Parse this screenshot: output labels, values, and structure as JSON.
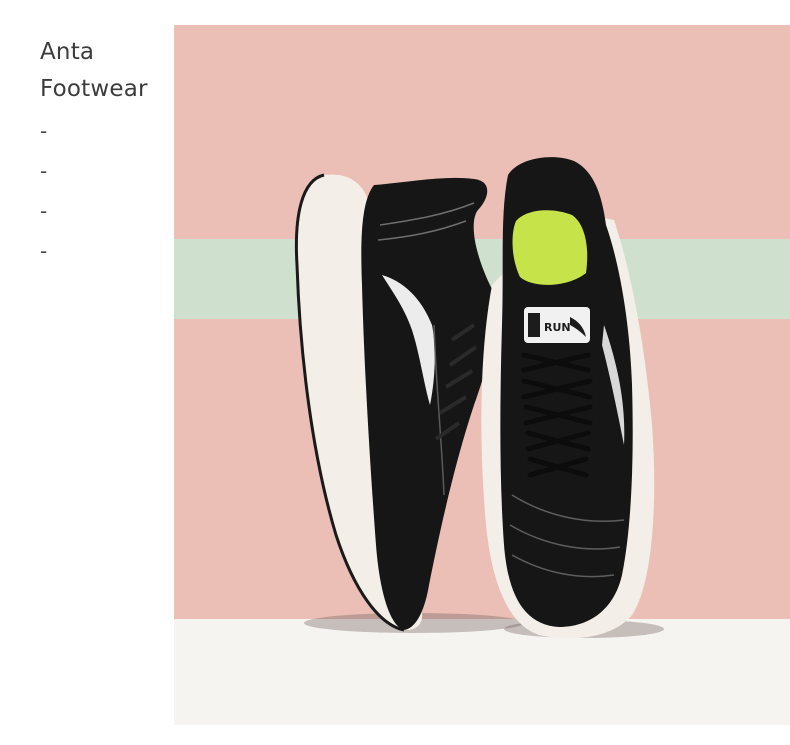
{
  "sidebar": {
    "brand_line1": "Anta",
    "brand_line2": "Footwear",
    "dashes": [
      "-",
      "-",
      "-",
      "-"
    ]
  },
  "photo": {
    "logo_text": "RUN",
    "colors": {
      "wall": "#ebbfb6",
      "stripe": "#cfe0cf",
      "floor": "#f6f4f1",
      "shoe_upper": "#161616",
      "sole": "#f3eee7",
      "lining": "#c7e34a"
    }
  }
}
